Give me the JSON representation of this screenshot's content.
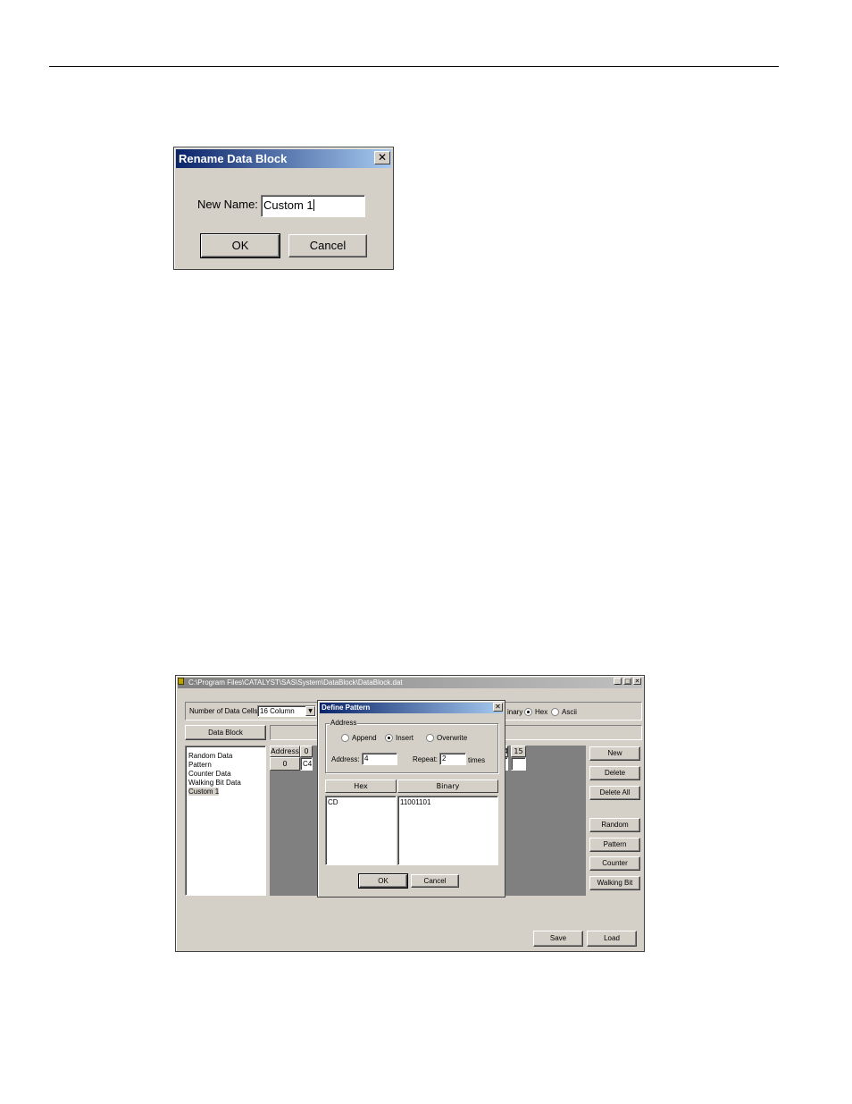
{
  "rename_dialog": {
    "title": "Rename Data Block",
    "close_glyph": "✕",
    "new_name_label": "New Name:",
    "new_name_value": "Custom 1",
    "ok_label": "OK",
    "cancel_label": "Cancel"
  },
  "datablock_window": {
    "title": "C:\\Program Files\\CATALYST\\SAS\\System\\DataBlock\\DataBlock.dat",
    "controls": {
      "minimize": "_",
      "maximize": "□",
      "close": "✕"
    },
    "cells_label": "Number of Data Cells:",
    "cells_value": "16  Column",
    "display_modes": [
      {
        "label": "inary",
        "selected": false
      },
      {
        "label": "Hex",
        "selected": true
      },
      {
        "label": "Ascii",
        "selected": false
      }
    ],
    "data_block_tab": "Data Block",
    "list_items": [
      "Random Data",
      "Pattern",
      "Counter Data",
      "Walking Bit Data",
      "Custom 1"
    ],
    "selected_item": "Custom 1",
    "grid": {
      "address_header": "Address",
      "col0_header": "0",
      "col15_header": "15",
      "col14_fragment": "4",
      "row_address": "0",
      "row_value": "C4"
    },
    "right_buttons": {
      "new": "New",
      "delete": "Delete",
      "delete_all": "Delete All",
      "random": "Random",
      "pattern": "Pattern",
      "counter": "Counter",
      "walking_bit": "Walking Bit"
    },
    "save_label": "Save",
    "load_label": "Load"
  },
  "define_pattern": {
    "title": "Define Pattern",
    "close_glyph": "✕",
    "address_group_label": "Address",
    "modes": [
      {
        "label": "Append",
        "selected": false
      },
      {
        "label": "Insert",
        "selected": true
      },
      {
        "label": "Overwrite",
        "selected": false
      }
    ],
    "address_label": "Address:",
    "address_value": "4",
    "repeat_label": "Repeat:",
    "repeat_value": "2",
    "times_label": "times",
    "hex_header": "Hex",
    "binary_header": "Binary",
    "hex_value": "CD",
    "binary_value": "11001101",
    "ok_label": "OK",
    "cancel_label": "Cancel"
  }
}
